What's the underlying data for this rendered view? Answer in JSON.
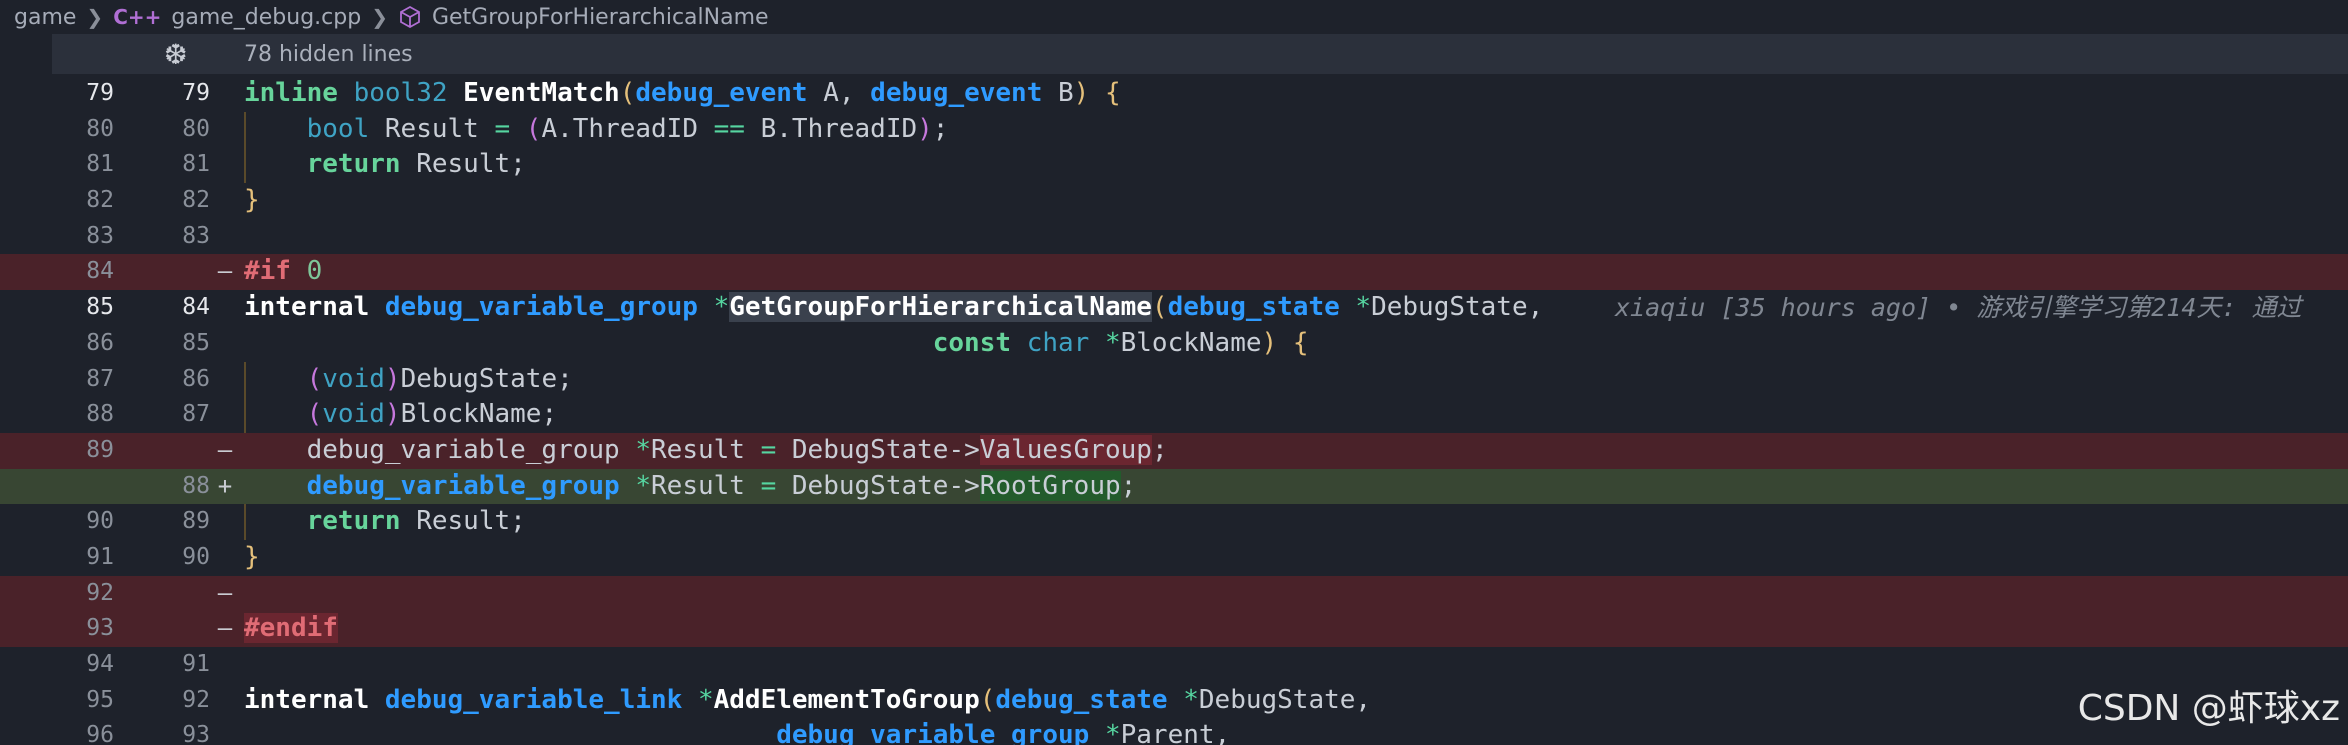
{
  "breadcrumb": {
    "folder": "game",
    "file": "game_debug.cpp",
    "symbol": "GetGroupForHierarchicalName"
  },
  "hidden": {
    "label": "78 hidden lines"
  },
  "lines": [
    {
      "old": "79",
      "new": "79",
      "kind": "ctx"
    },
    {
      "old": "80",
      "new": "80",
      "kind": "ctx"
    },
    {
      "old": "81",
      "new": "81",
      "kind": "ctx"
    },
    {
      "old": "82",
      "new": "82",
      "kind": "ctx"
    },
    {
      "old": "83",
      "new": "83",
      "kind": "ctx"
    },
    {
      "old": "84",
      "new": "",
      "kind": "del",
      "marker": "—"
    },
    {
      "old": "85",
      "new": "84",
      "kind": "ctx"
    },
    {
      "old": "86",
      "new": "85",
      "kind": "ctx"
    },
    {
      "old": "87",
      "new": "86",
      "kind": "ctx"
    },
    {
      "old": "88",
      "new": "87",
      "kind": "ctx"
    },
    {
      "old": "89",
      "new": "",
      "kind": "del",
      "marker": "—"
    },
    {
      "old": "",
      "new": "88",
      "kind": "add",
      "marker": "+"
    },
    {
      "old": "90",
      "new": "89",
      "kind": "ctx"
    },
    {
      "old": "91",
      "new": "90",
      "kind": "ctx"
    },
    {
      "old": "92",
      "new": "",
      "kind": "del",
      "marker": "—"
    },
    {
      "old": "93",
      "new": "",
      "kind": "del",
      "marker": "—"
    },
    {
      "old": "94",
      "new": "91",
      "kind": "ctx"
    },
    {
      "old": "95",
      "new": "92",
      "kind": "ctx"
    },
    {
      "old": "96",
      "new": "93",
      "kind": "ctx"
    }
  ],
  "code": {
    "l79": {
      "t1": "inline",
      "t2": " ",
      "t3": "bool32",
      "t4": " ",
      "t5": "EventMatch",
      "t6": "(",
      "t7": "debug_event",
      "t8": " A, ",
      "t9": "debug_event",
      "t10": " B",
      "t11": ")",
      "t12": " {"
    },
    "l80": {
      "t1": "bool",
      "t2": " Result ",
      "t3": "=",
      "t4": " ",
      "t5": "(",
      "t6": "A.ThreadID ",
      "t7": "==",
      "t8": " B.ThreadID",
      "t9": ")",
      "t10": ";"
    },
    "l81": {
      "t1": "return",
      "t2": " Result;"
    },
    "l82": {
      "t1": "}"
    },
    "l84": {
      "t1": "#if",
      "t2": " ",
      "t3": "0"
    },
    "l85": {
      "t1": "internal",
      "t2": " ",
      "t3": "debug_variable_group",
      "t4": " ",
      "t5": "*",
      "t6": "GetGroupForHierarchicalName",
      "t7": "(",
      "t8": "debug_state",
      "t9": " ",
      "t10": "*",
      "t11": "DebugState,"
    },
    "blame": "xiaqiu [35 hours ago] • 游戏引擎学习第214天: 通过",
    "l86": {
      "t1": "const",
      "t2": " ",
      "t3": "char",
      "t4": " ",
      "t5": "*",
      "t6": "BlockName",
      "t7": ")",
      "t8": " {"
    },
    "l87": {
      "t1": "(",
      "t2": "void",
      "t3": ")",
      "t4": "DebugState;"
    },
    "l88": {
      "t1": "(",
      "t2": "void",
      "t3": ")",
      "t4": "BlockName;"
    },
    "l89": {
      "t1": "debug_variable_group",
      "t2": " ",
      "t3": "*",
      "t4": "Result ",
      "t5": "=",
      "t6": " DebugState",
      "t7": "->",
      "t8": "ValuesGroup",
      "t9": ";"
    },
    "l88n": {
      "t1": "debug_variable_group",
      "t2": " ",
      "t3": "*",
      "t4": "Result ",
      "t5": "=",
      "t6": " DebugState",
      "t7": "->",
      "t8": "RootGroup",
      "t9": ";"
    },
    "l90": {
      "t1": "return",
      "t2": " Result;"
    },
    "l91": {
      "t1": "}"
    },
    "l93": {
      "t1": "#endif"
    },
    "l95": {
      "t1": "internal",
      "t2": " ",
      "t3": "debug_variable_link",
      "t4": " ",
      "t5": "*",
      "t6": "AddElementToGroup",
      "t7": "(",
      "t8": "debug_state",
      "t9": " ",
      "t10": "*",
      "t11": "DebugState,"
    },
    "l96": {
      "t1": "debug_variable_group",
      "t2": " ",
      "t3": "*",
      "t4": "Parent,"
    }
  },
  "watermark": "CSDN @虾球xz",
  "colors": {
    "deleted_bg": "#4a2229",
    "added_bg": "#384633",
    "editor_bg": "#1e222b"
  }
}
